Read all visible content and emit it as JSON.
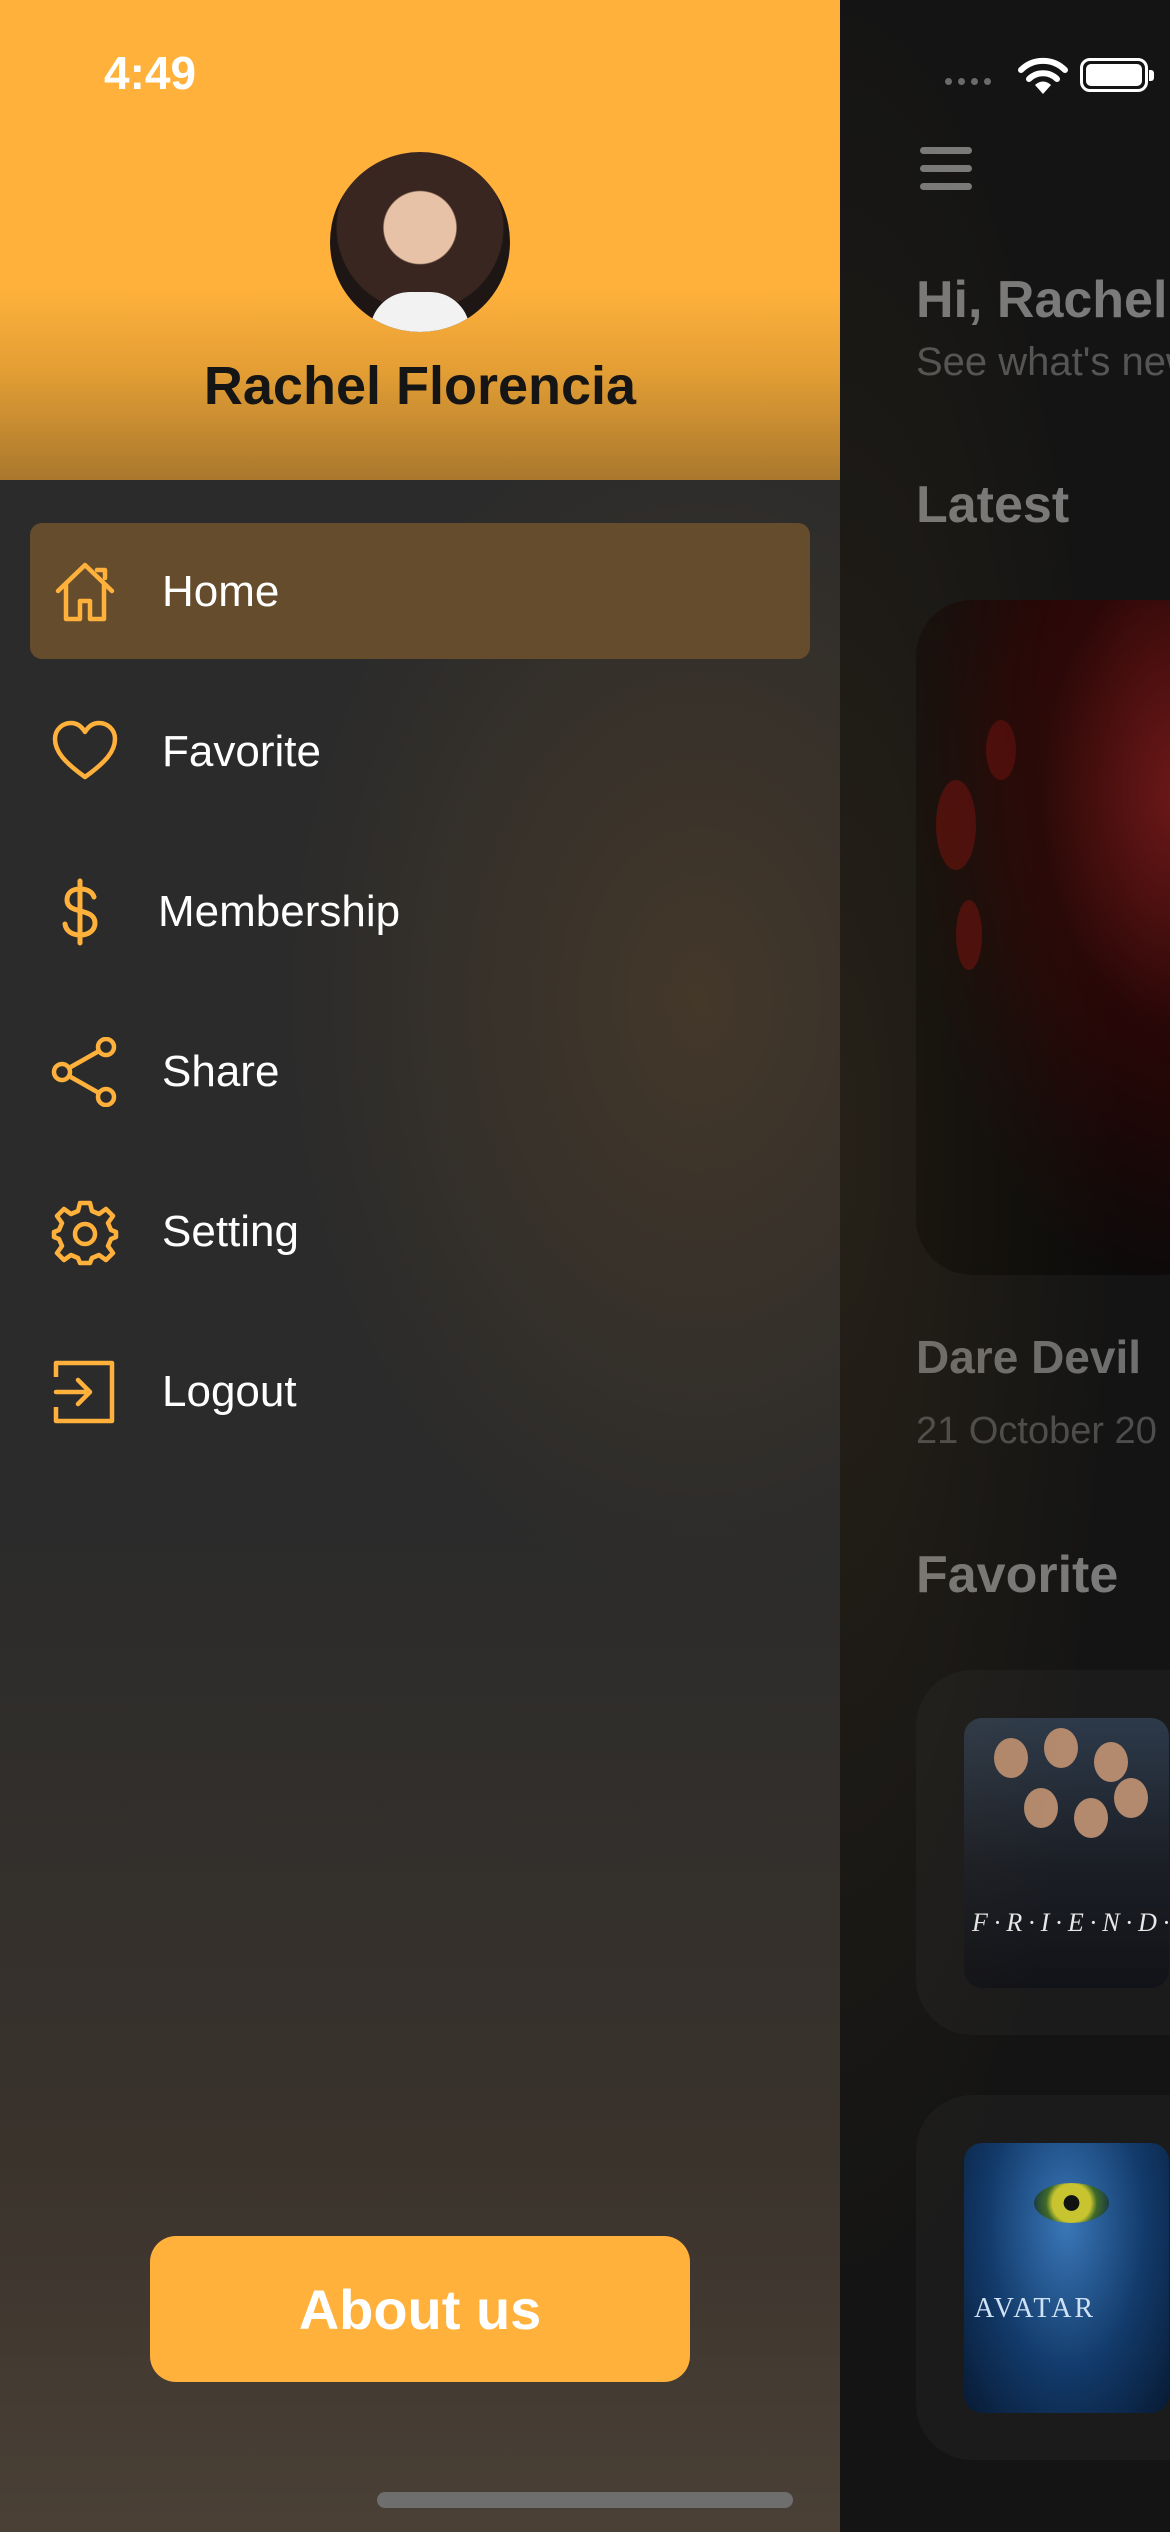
{
  "status_bar": {
    "time": "4:49"
  },
  "drawer": {
    "user_name": "Rachel Florencia",
    "menu": [
      {
        "label": "Home",
        "icon": "home-icon",
        "active": true
      },
      {
        "label": "Favorite",
        "icon": "heart-icon",
        "active": false
      },
      {
        "label": "Membership",
        "icon": "dollar-icon",
        "active": false
      },
      {
        "label": "Share",
        "icon": "share-icon",
        "active": false
      },
      {
        "label": "Setting",
        "icon": "gear-icon",
        "active": false
      },
      {
        "label": "Logout",
        "icon": "logout-icon",
        "active": false
      }
    ],
    "about_button": "About us"
  },
  "home": {
    "greeting": "Hi, Rachel",
    "sub_greeting": "See what's new",
    "latest_title": "Latest",
    "latest_movie": {
      "title": "Dare Devil",
      "date": "21 October 20"
    },
    "favorite_title": "Favorite",
    "favorites": [
      {
        "caption": "F·R·I·E·N·D·S"
      },
      {
        "caption": "AVATAR"
      }
    ]
  },
  "colors": {
    "accent": "#FFB13B",
    "drawer_bg": "#2B2B2B",
    "active_item": "#644C2C"
  }
}
